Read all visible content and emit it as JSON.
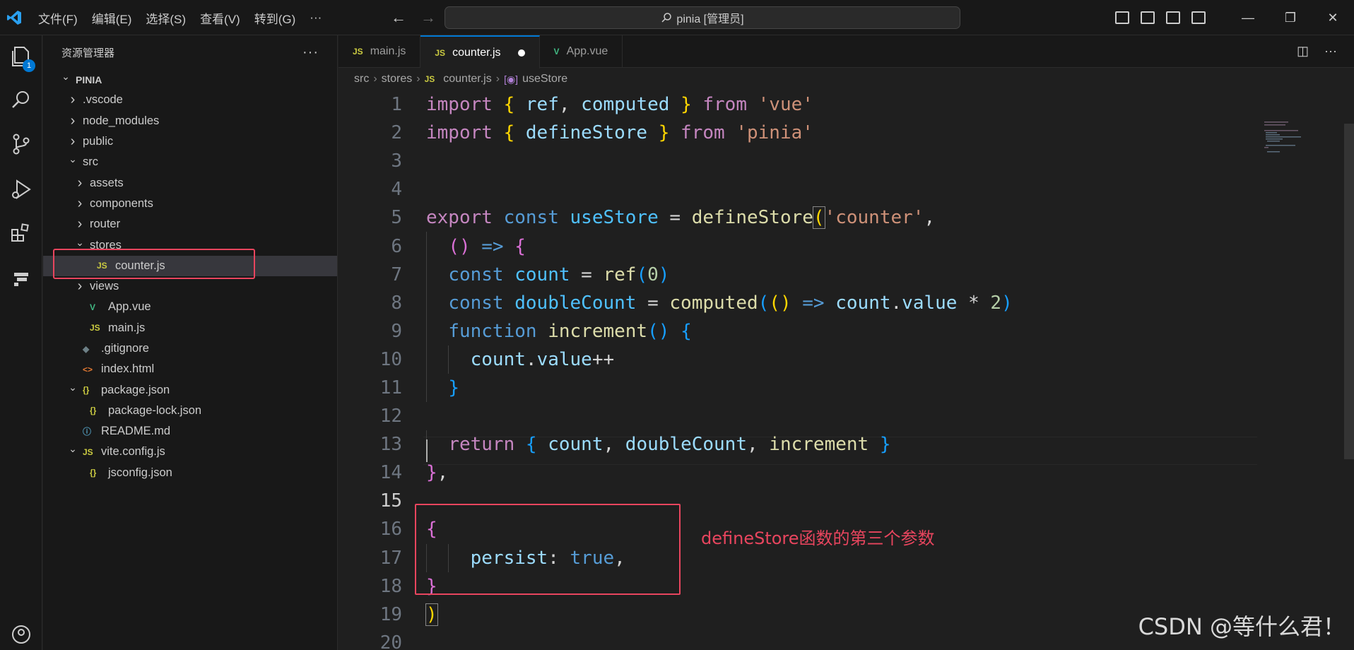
{
  "titlebar": {
    "menu": [
      "文件(F)",
      "编辑(E)",
      "选择(S)",
      "查看(V)",
      "转到(G)",
      "···"
    ],
    "search_text": "pinia [管理员]",
    "window_buttons": [
      "—",
      "❐",
      "✕"
    ]
  },
  "activity": {
    "explorer_badge": "1"
  },
  "sidebar": {
    "header": "资源管理器",
    "more": "···",
    "tree": [
      {
        "label": "PINIA",
        "depth": 0,
        "chevron": "open",
        "icon": "",
        "type": "root"
      },
      {
        "label": ".vscode",
        "depth": 1,
        "chevron": "closed",
        "icon": "",
        "type": "folder"
      },
      {
        "label": "node_modules",
        "depth": 1,
        "chevron": "closed",
        "icon": "",
        "type": "folder"
      },
      {
        "label": "public",
        "depth": 1,
        "chevron": "closed",
        "icon": "",
        "type": "folder"
      },
      {
        "label": "src",
        "depth": 1,
        "chevron": "open",
        "icon": "",
        "type": "folder"
      },
      {
        "label": "assets",
        "depth": 2,
        "chevron": "closed",
        "icon": "",
        "type": "folder"
      },
      {
        "label": "components",
        "depth": 2,
        "chevron": "closed",
        "icon": "",
        "type": "folder"
      },
      {
        "label": "router",
        "depth": 2,
        "chevron": "closed",
        "icon": "",
        "type": "folder"
      },
      {
        "label": "stores",
        "depth": 2,
        "chevron": "open",
        "icon": "",
        "type": "folder"
      },
      {
        "label": "counter.js",
        "depth": 3,
        "chevron": "none",
        "icon": "JS",
        "type": "js",
        "selected": true
      },
      {
        "label": "views",
        "depth": 2,
        "chevron": "closed",
        "icon": "",
        "type": "folder"
      },
      {
        "label": "App.vue",
        "depth": 2,
        "chevron": "none",
        "icon": "V",
        "type": "vue"
      },
      {
        "label": "main.js",
        "depth": 2,
        "chevron": "none",
        "icon": "JS",
        "type": "js"
      },
      {
        "label": ".gitignore",
        "depth": 1,
        "chevron": "none",
        "icon": "◆",
        "type": "git"
      },
      {
        "label": "index.html",
        "depth": 1,
        "chevron": "none",
        "icon": "<>",
        "type": "html"
      },
      {
        "label": "package.json",
        "depth": 1,
        "chevron": "open",
        "icon": "{}",
        "type": "json"
      },
      {
        "label": "package-lock.json",
        "depth": 2,
        "chevron": "none",
        "icon": "{}",
        "type": "json"
      },
      {
        "label": "README.md",
        "depth": 1,
        "chevron": "none",
        "icon": "ⓘ",
        "type": "info"
      },
      {
        "label": "vite.config.js",
        "depth": 1,
        "chevron": "open",
        "icon": "JS",
        "type": "js"
      },
      {
        "label": "jsconfig.json",
        "depth": 2,
        "chevron": "none",
        "icon": "{}",
        "type": "json"
      }
    ]
  },
  "tabs": [
    {
      "label": "main.js",
      "icon": "JS",
      "type": "js",
      "active": false
    },
    {
      "label": "counter.js",
      "icon": "JS",
      "type": "js",
      "active": true,
      "dirty": true
    },
    {
      "label": "App.vue",
      "icon": "V",
      "type": "vue",
      "active": false
    }
  ],
  "breadcrumbs": [
    "src",
    "stores",
    "counter.js",
    "useStore"
  ],
  "code": {
    "line_numbers": [
      "1",
      "2",
      "3",
      "4",
      "5",
      "6",
      "7",
      "8",
      "9",
      "10",
      "11",
      "12",
      "13",
      "14",
      "15",
      "16",
      "17",
      "18",
      "19",
      "20"
    ],
    "current_line": 15,
    "lines": [
      [
        [
          "kw",
          "import"
        ],
        [
          "op",
          " "
        ],
        [
          "p1",
          "{"
        ],
        [
          "op",
          " "
        ],
        [
          "var",
          "ref"
        ],
        [
          "op",
          ", "
        ],
        [
          "var",
          "computed"
        ],
        [
          "op",
          " "
        ],
        [
          "p1",
          "}"
        ],
        [
          "op",
          " "
        ],
        [
          "kw",
          "from"
        ],
        [
          "op",
          " "
        ],
        [
          "str",
          "'vue'"
        ]
      ],
      [
        [
          "kw",
          "import"
        ],
        [
          "op",
          " "
        ],
        [
          "p1",
          "{"
        ],
        [
          "op",
          " "
        ],
        [
          "var",
          "defineStore"
        ],
        [
          "op",
          " "
        ],
        [
          "p1",
          "}"
        ],
        [
          "op",
          " "
        ],
        [
          "kw",
          "from"
        ],
        [
          "op",
          " "
        ],
        [
          "str",
          "'pinia'"
        ]
      ],
      [],
      [],
      [
        [
          "kw",
          "export"
        ],
        [
          "op",
          " "
        ],
        [
          "kb",
          "const"
        ],
        [
          "op",
          " "
        ],
        [
          "vc",
          "useStore"
        ],
        [
          "op",
          " = "
        ],
        [
          "fn",
          "defineStore"
        ],
        [
          "p1 match",
          "("
        ],
        [
          "str",
          "'counter'"
        ],
        [
          "op",
          ","
        ]
      ],
      [
        [
          "op",
          "  "
        ],
        [
          "p2",
          "()"
        ],
        [
          "op",
          " "
        ],
        [
          "kb",
          "=>"
        ],
        [
          "op",
          " "
        ],
        [
          "p2",
          "{"
        ]
      ],
      [
        [
          "op",
          "  "
        ],
        [
          "kb",
          "const"
        ],
        [
          "op",
          " "
        ],
        [
          "vc",
          "count"
        ],
        [
          "op",
          " = "
        ],
        [
          "fn",
          "ref"
        ],
        [
          "p3",
          "("
        ],
        [
          "num",
          "0"
        ],
        [
          "p3",
          ")"
        ]
      ],
      [
        [
          "op",
          "  "
        ],
        [
          "kb",
          "const"
        ],
        [
          "op",
          " "
        ],
        [
          "vc",
          "doubleCount"
        ],
        [
          "op",
          " = "
        ],
        [
          "fn",
          "computed"
        ],
        [
          "p3",
          "("
        ],
        [
          "p1",
          "()"
        ],
        [
          "op",
          " "
        ],
        [
          "kb",
          "=>"
        ],
        [
          "op",
          " "
        ],
        [
          "var",
          "count"
        ],
        [
          "op",
          "."
        ],
        [
          "var",
          "value"
        ],
        [
          "op",
          " * "
        ],
        [
          "num",
          "2"
        ],
        [
          "p3",
          ")"
        ]
      ],
      [
        [
          "op",
          "  "
        ],
        [
          "kb",
          "function"
        ],
        [
          "op",
          " "
        ],
        [
          "fn",
          "increment"
        ],
        [
          "p3",
          "()"
        ],
        [
          "op",
          " "
        ],
        [
          "p3",
          "{"
        ]
      ],
      [
        [
          "op",
          "    "
        ],
        [
          "var",
          "count"
        ],
        [
          "op",
          "."
        ],
        [
          "var",
          "value"
        ],
        [
          "op",
          "++"
        ]
      ],
      [
        [
          "op",
          "  "
        ],
        [
          "p3",
          "}"
        ]
      ],
      [],
      [
        [
          "op",
          "  "
        ],
        [
          "kw",
          "return"
        ],
        [
          "op",
          " "
        ],
        [
          "p3",
          "{"
        ],
        [
          "op",
          " "
        ],
        [
          "var",
          "count"
        ],
        [
          "op",
          ", "
        ],
        [
          "var",
          "doubleCount"
        ],
        [
          "op",
          ", "
        ],
        [
          "fn",
          "increment"
        ],
        [
          "op",
          " "
        ],
        [
          "p3",
          "}"
        ]
      ],
      [
        [
          "p2",
          "}"
        ],
        [
          "op",
          ","
        ]
      ],
      [],
      [
        [
          "p2",
          "{"
        ]
      ],
      [
        [
          "op",
          "    "
        ],
        [
          "var",
          "persist"
        ],
        [
          "op",
          ": "
        ],
        [
          "kb",
          "true"
        ],
        [
          "op",
          ","
        ]
      ],
      [
        [
          "p2",
          "}"
        ]
      ],
      [
        [
          "p1 match",
          ")"
        ]
      ],
      []
    ]
  },
  "annotation": "defineStore函数的第三个参数",
  "watermark": "CSDN @等什么君！",
  "colors": {
    "accent": "#0078d4",
    "annotation": "#e8455e"
  }
}
